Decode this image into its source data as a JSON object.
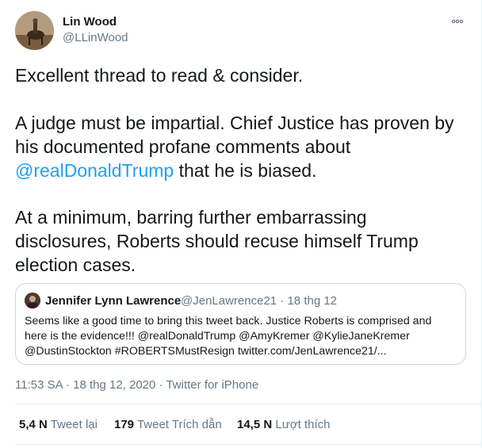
{
  "author": {
    "name": "Lin Wood",
    "handle": "@LLinWood"
  },
  "tweet": {
    "line1": "Excellent thread to read & consider.",
    "line2": "A judge must be impartial. Chief Justice has proven by",
    "line3": "his documented profane comments about",
    "mention": "@realDonaldTrump",
    "line4_rest": " that he is biased.",
    "line5": "At a minimum, barring further embarrassing",
    "line6": "disclosures, Roberts should recuse himself Trump",
    "line7": "election cases."
  },
  "quoted_tweet": {
    "name": "Jennifer Lynn Lawrence",
    "meta": "@JenLawrence21 · 18 thg 12",
    "line1": "Seems like a good time to bring this tweet back. Justice Roberts is comprised and",
    "line2": "here is the evidence!!! @realDonaldTrump @AmyKremer @KylieJaneKremer",
    "line3": "@DustinStockton #ROBERTSMustResign twitter.com/JenLawrence21/..."
  },
  "meta": {
    "time_date": "11:53 SA · 18 thg 12, 2020",
    "separator": " · ",
    "source": "Twitter for iPhone"
  },
  "stats": {
    "retweets_count": "5,4 N",
    "retweets_label": "Tweet lại",
    "quotes_count": "179",
    "quotes_label": "Tweet Trích dẫn",
    "likes_count": "14,5 N",
    "likes_label": "Lượt thích"
  },
  "colors": {
    "link": "#1da1f2",
    "secondary": "#657786",
    "border": "#e6ecf0"
  },
  "icons": {
    "more": "more-horizontal-icon"
  }
}
